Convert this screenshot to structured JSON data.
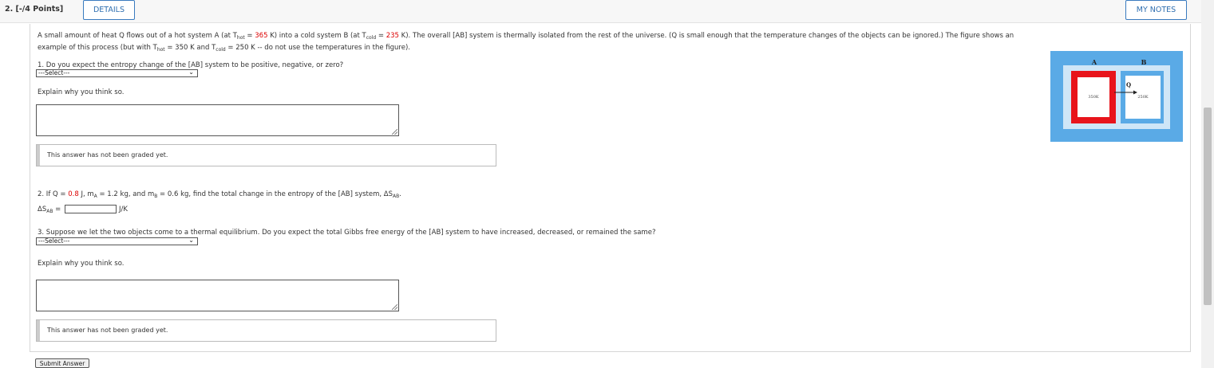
{
  "header": {
    "question_number": "2. [-/4 Points]",
    "details_label": "DETAILS",
    "my_notes_label": "MY NOTES"
  },
  "intro": {
    "line1_a": "A small amount of heat Q flows out of a hot system A (at T",
    "hot_sub": "hot",
    "line1_b": " = ",
    "t_hot_value": "365",
    "line1_c": " K) into a cold system B (at T",
    "cold_sub": "cold",
    "line1_d": " = ",
    "t_cold_value": "235",
    "line1_e": " K). The overall [AB] system is thermally isolated from the rest of the universe. (Q is small enough that the temperature changes of the objects can be ignored.) The figure shows an",
    "line2_a": "example of this process (but with T",
    "line2_b": " = 350 K and T",
    "line2_c": " = 250 K -- do not use the temperatures in the figure)."
  },
  "part1": {
    "question": "1. Do you expect the entropy change of the [AB] system to be positive, negative, or zero?",
    "select_value": "---Select---",
    "explain_label": "Explain why you think so.",
    "graded_text": "This answer has not been graded yet."
  },
  "part2": {
    "q_a": "2. If Q = ",
    "q_value": "0.8",
    "q_b": " J, m",
    "sub_a": "A",
    "q_c": " = 1.2 kg, and m",
    "sub_b": "B",
    "q_d": " = 0.6 kg, find the total change in the entropy of the [AB] system, ΔS",
    "sub_ab": "AB",
    "q_e": ".",
    "answer_label": "ΔS",
    "answer_sub": "AB",
    "answer_eq": " =",
    "unit": "J/K"
  },
  "part3": {
    "question": "3. Suppose we let the two objects come to a thermal equilibrium. Do you expect the total Gibbs free energy of the [AB] system to have increased, decreased, or remained the same?",
    "select_value": "---Select---",
    "explain_label": "Explain why you think so.",
    "graded_text": "This answer has not been graded yet."
  },
  "submit_label": "Submit Answer",
  "figure": {
    "label_a": "A",
    "label_b": "B",
    "label_q": "Q",
    "temp_a": "350K",
    "temp_b": "250K",
    "colors": {
      "background": "#5aaae6",
      "hot": "#e8141b",
      "cold": "#cfe6f7"
    }
  }
}
